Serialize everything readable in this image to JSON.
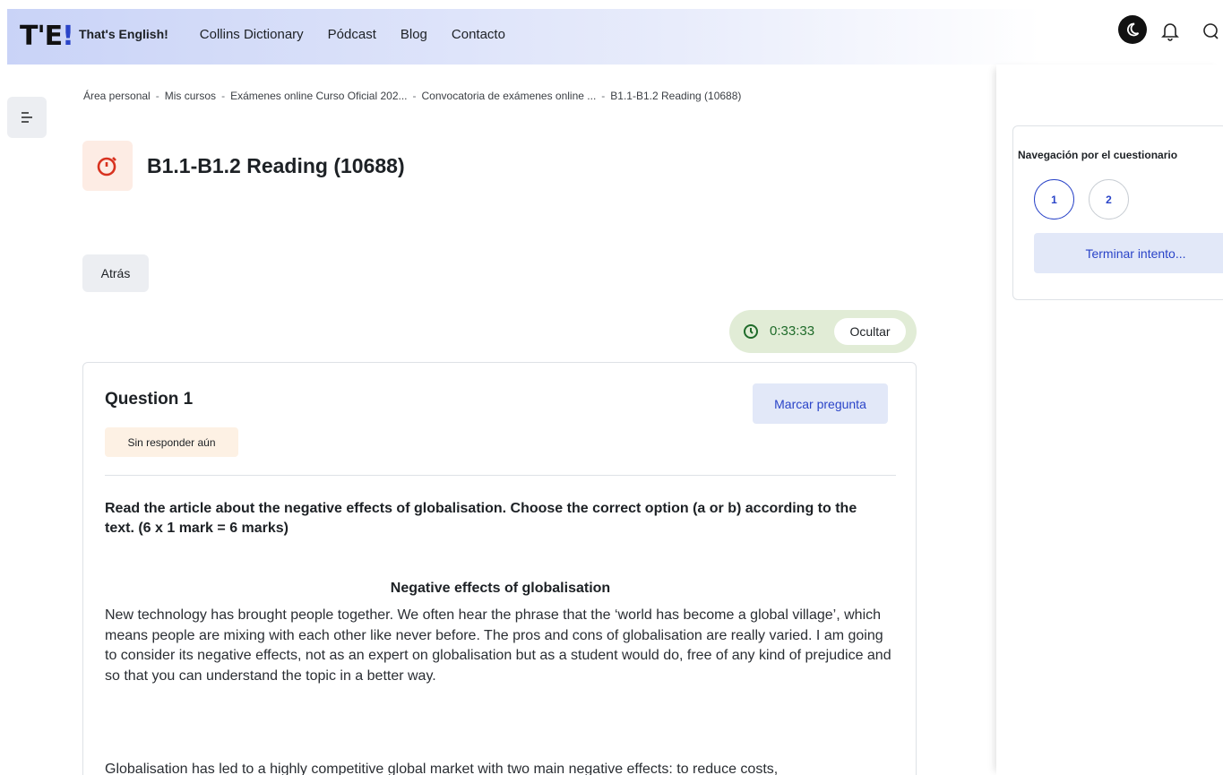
{
  "header": {
    "logo": "T'E",
    "logo_bang": "!",
    "nav": [
      "That's English!",
      "Collins Dictionary",
      "Pódcast",
      "Blog",
      "Contacto"
    ]
  },
  "breadcrumb": [
    "Área personal",
    "Mis cursos",
    "Exámenes online Curso Oficial 202...",
    "Convocatoria de exámenes online ...",
    "B1.1-B1.2 Reading (10688)"
  ],
  "page": {
    "title": "B1.1-B1.2 Reading (10688)",
    "back_label": "Atrás"
  },
  "timer": {
    "time": "0:33:33",
    "hide_label": "Ocultar"
  },
  "question": {
    "title": "Question 1",
    "state": "Sin responder aún",
    "flag_label": "Marcar pregunta",
    "instructions": "Read the article about the negative effects of globalisation. Choose the correct option (a or b) according to the text. (6 x 1 mark = 6 marks)",
    "article_title": "Negative effects of globalisation",
    "paragraph1": "New technology has brought people together. We often hear the phrase that the ‘world has become a global village’, which means people are mixing with each other like never before. The pros and cons of globalisation are really varied. I am going to consider its negative effects, not as an expert on globalisation but as a student would do, free of any kind of prejudice and so that you can understand the topic in a better way.",
    "paragraph2": "Globalisation has led to a highly competitive global market with two main negative effects: to reduce costs,"
  },
  "quiz_nav": {
    "title": "Navegación por el cuestionario",
    "questions": [
      "1",
      "2"
    ],
    "finish_label": "Terminar intento..."
  }
}
